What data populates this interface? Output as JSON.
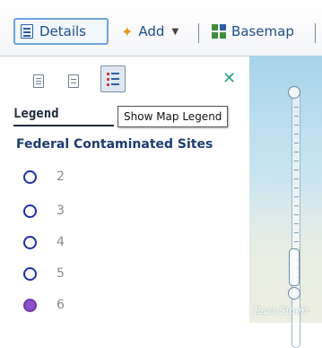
{
  "toolbar": {
    "details_label": "Details",
    "add_label": "Add",
    "basemap_label": "Basemap"
  },
  "panel": {
    "legend_heading": "Legend",
    "tooltip": "Show Map Legend",
    "layer_title": "Federal Contaminated Sites",
    "items": [
      {
        "label": "2",
        "symbol": "hollow-circle"
      },
      {
        "label": "3",
        "symbol": "hollow-circle"
      },
      {
        "label": "4",
        "symbol": "hollow-circle"
      },
      {
        "label": "5",
        "symbol": "hollow-circle"
      },
      {
        "label": "6",
        "symbol": "filled-circle"
      }
    ]
  },
  "map": {
    "partial_label": "East Siberi"
  },
  "colors": {
    "accent": "#2d5fa1",
    "symbol_stroke": "#1f2fa8",
    "symbol_fill_6": "#8e4fc9",
    "close": "#2e9e8c"
  }
}
